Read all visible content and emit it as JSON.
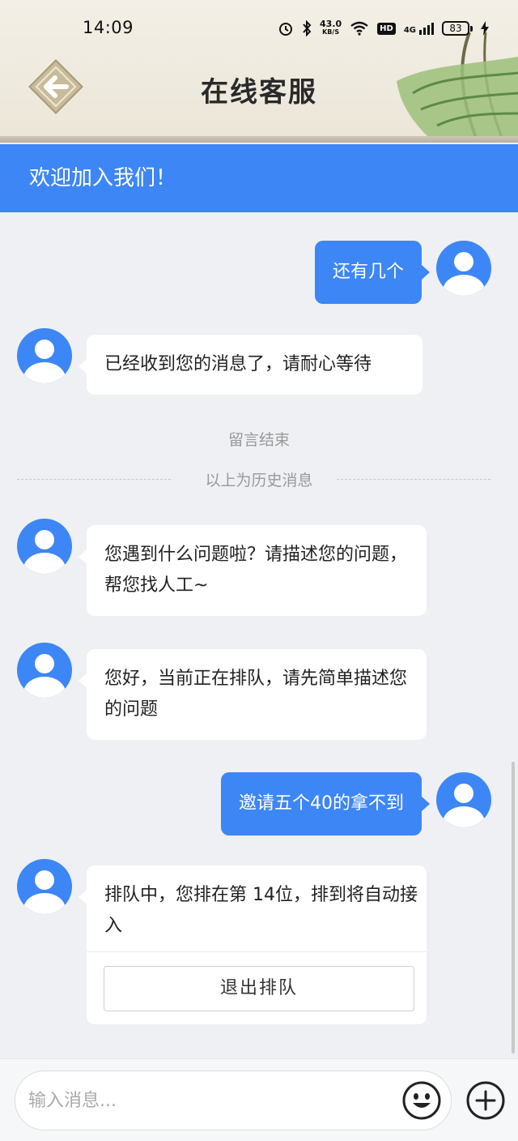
{
  "status_bar": {
    "time": "14:09",
    "net_speed_value": "43.0",
    "net_speed_unit": "KB/S",
    "hd_label": "HD",
    "network_label": "4G",
    "battery": "83",
    "icons": [
      "alarm-icon",
      "bluetooth-icon",
      "wifi-icon",
      "signal-icon",
      "charging-icon"
    ]
  },
  "header": {
    "title": "在线客服",
    "back_icon": "arrow-left-icon"
  },
  "banner": {
    "text": "欢迎加入我们！"
  },
  "messages": [
    {
      "from": "user",
      "text": "还有几个"
    },
    {
      "from": "agent",
      "text": "已经收到您的消息了，请耐心等待"
    },
    {
      "from": "agent",
      "text": "您遇到什么问题啦？请描述您的问题，帮您找人工~"
    },
    {
      "from": "agent",
      "text": "您好，当前正在排队，请先简单描述您的问题"
    },
    {
      "from": "user",
      "text": "邀请五个40的拿不到"
    },
    {
      "from": "agent",
      "text": "排队中，您排在第 14位，排到将自动接入"
    }
  ],
  "system": {
    "session_end": "留言结束",
    "history_divider": "以上为历史消息"
  },
  "queue": {
    "quit_button": "退出排队"
  },
  "input": {
    "placeholder": "输入消息...",
    "emoji_icon": "smiley-icon",
    "add_icon": "plus-circle-icon"
  },
  "colors": {
    "accent": "#3d86f6",
    "background": "#eef0f4",
    "header_bg": "#f3efe6"
  }
}
